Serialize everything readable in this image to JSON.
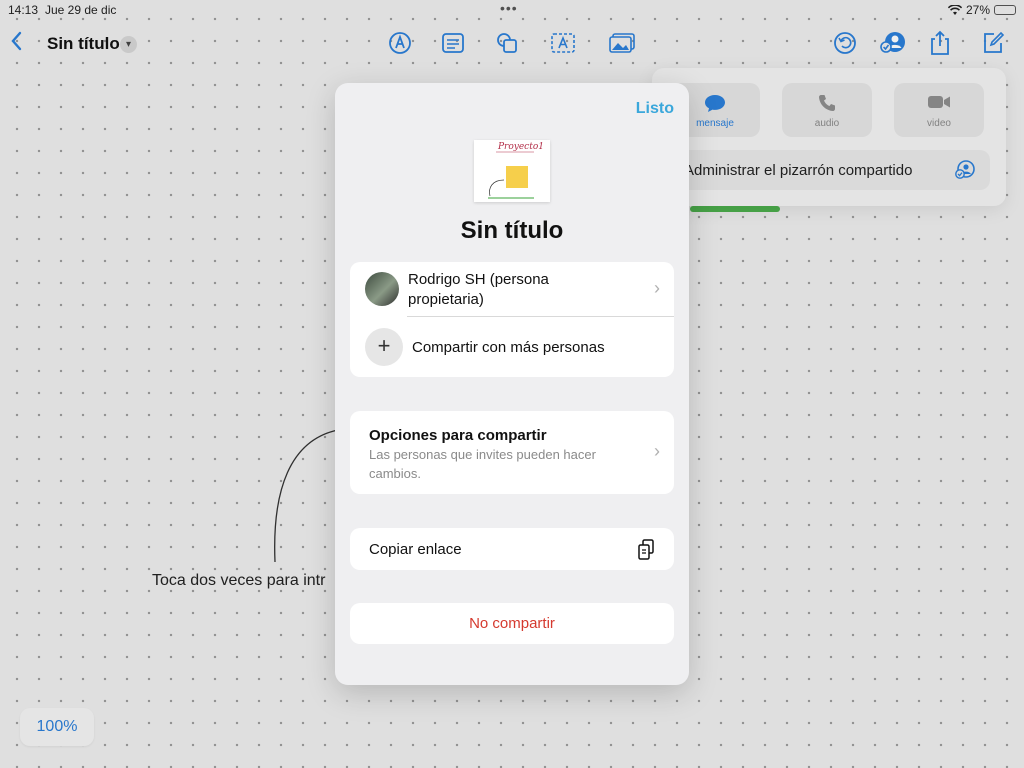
{
  "status": {
    "time": "14:13",
    "date": "Jue 29 de dic",
    "battery": "27%"
  },
  "toolbar": {
    "title": "Sin título"
  },
  "canvas": {
    "hint": "Toca dos veces para intr",
    "zoom": "100%"
  },
  "popover": {
    "buttons": [
      {
        "label": "mensaje"
      },
      {
        "label": "audio"
      },
      {
        "label": "video"
      }
    ],
    "manage": "Administrar el pizarrón compartido"
  },
  "modal": {
    "done": "Listo",
    "thumb_text": "Proyecto1",
    "title": "Sin título",
    "owner": "Rodrigo SH (persona propietaria)",
    "share_more": "Compartir con más personas",
    "options_title": "Opciones para compartir",
    "options_sub": "Las personas que invites pueden hacer cambios.",
    "copy_link": "Copiar enlace",
    "stop_sharing": "No compartir"
  },
  "colors": {
    "accent": "#2b7fd9",
    "done": "#3aa7db",
    "destructive": "#d53a2f",
    "note": "#f6cf4b"
  }
}
